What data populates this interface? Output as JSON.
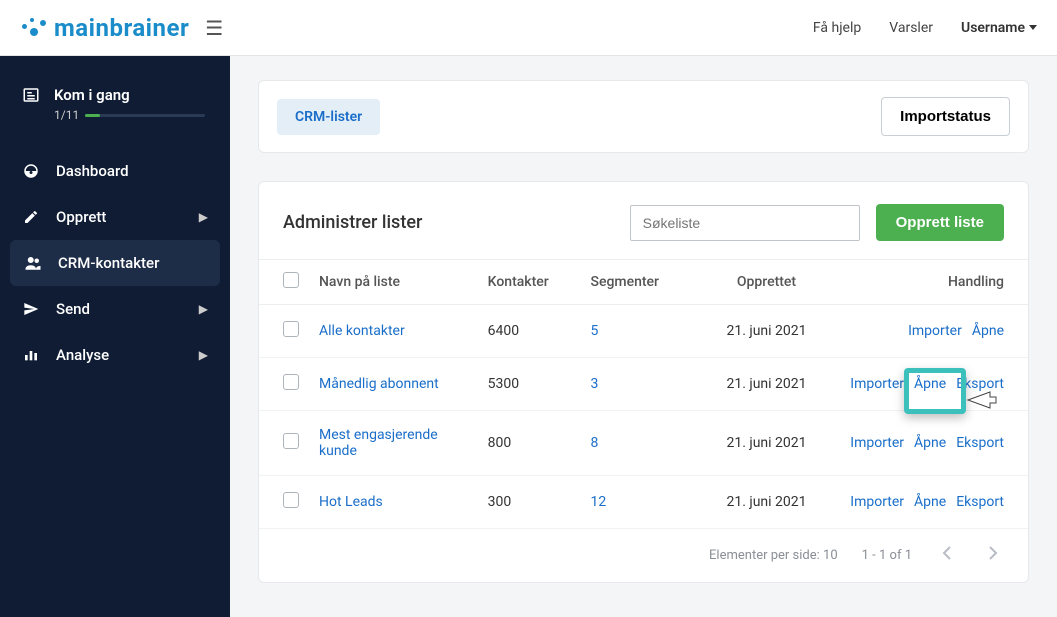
{
  "header": {
    "logo_main": "main",
    "logo_brain": "brainer",
    "help": "Få hjelp",
    "alerts": "Varsler",
    "username": "Username"
  },
  "sidebar": {
    "get_started": {
      "label": "Kom i gang",
      "progress": "1/11"
    },
    "items": [
      {
        "label": "Dashboard",
        "has_sub": false,
        "active": false
      },
      {
        "label": "Opprett",
        "has_sub": true,
        "active": false
      },
      {
        "label": "CRM-kontakter",
        "has_sub": false,
        "active": true
      },
      {
        "label": "Send",
        "has_sub": true,
        "active": false
      },
      {
        "label": "Analyse",
        "has_sub": true,
        "active": false
      }
    ]
  },
  "page": {
    "tab_label": "CRM-lister",
    "import_status_btn": "Importstatus",
    "manage_title": "Administrer lister",
    "search_placeholder": "Søkeliste",
    "create_btn": "Opprett liste"
  },
  "table": {
    "columns": {
      "name": "Navn på liste",
      "contacts": "Kontakter",
      "segments": "Segmenter",
      "created": "Opprettet",
      "action": "Handling"
    },
    "actions": {
      "import": "Importer",
      "open": "Åpne",
      "export": "Eksport"
    },
    "rows": [
      {
        "name": "Alle kontakter",
        "contacts": "6400",
        "segments": "5",
        "created": "21. juni 2021",
        "show_export": false
      },
      {
        "name": "Månedlig abonnent",
        "contacts": "5300",
        "segments": "3",
        "created": "21. juni 2021",
        "show_export": true
      },
      {
        "name": "Mest engasjerende kunde",
        "contacts": "800",
        "segments": "8",
        "created": "21. juni 2021",
        "show_export": true
      },
      {
        "name": "Hot Leads",
        "contacts": "300",
        "segments": "12",
        "created": "21. juni 2021",
        "show_export": true
      }
    ],
    "pagination": {
      "per_page_label": "Elementer per side:",
      "per_page_value": "10",
      "range": "1 - 1 of 1"
    }
  }
}
